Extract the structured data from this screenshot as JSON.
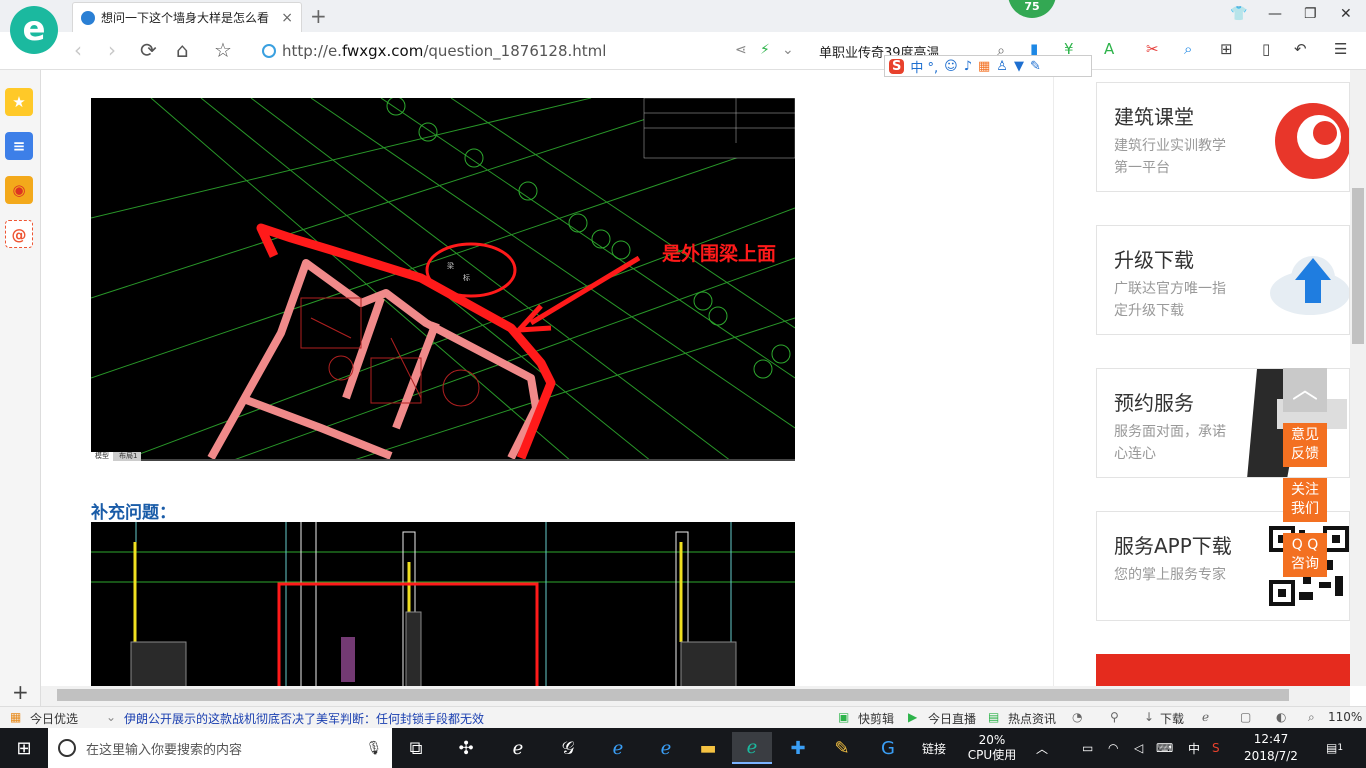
{
  "browser": {
    "logo_letter": "e",
    "tab_title": "想问一下这个墙身大样是怎么看",
    "tab_close": "×",
    "new_tab": "+",
    "badge": "75",
    "url_prefix": "http://e.",
    "url_domain": "fwxgx.com",
    "url_path": "/question_1876128.html",
    "search_text": "单职业传奇39度高温",
    "ime_logo": "S",
    "ime_mode": "中 °,"
  },
  "nav": {
    "back": "‹",
    "forward": "›",
    "reload": "⟳",
    "home": "⌂",
    "star": "☆"
  },
  "page": {
    "cad_annotation": "是外围梁上面",
    "cad_labels": [
      "模型",
      "布局1"
    ],
    "supplement_label": "补充问题："
  },
  "sidebar_cards": [
    {
      "title": "建筑课堂",
      "desc": "建筑行业实训教学第一平台"
    },
    {
      "title": "升级下载",
      "desc": "广联达官方唯一指定升级下载"
    },
    {
      "title": "预约服务",
      "desc": "服务面对面，承诺心连心"
    },
    {
      "title": "服务APP下载",
      "desc": "您的掌上服务专家"
    }
  ],
  "float_buttons": [
    "意见\n反馈",
    "关注\n我们",
    "Q Q\n咨询"
  ],
  "float_top_icon": "︿",
  "statusbar": {
    "today_picks": "今日优选",
    "news": "伊朗公开展示的这款战机彻底否决了美军判断：任何封锁手段都无效",
    "clip": "快剪辑",
    "live": "今日直播",
    "hot": "热点资讯",
    "download": "下载",
    "zoom": "110%"
  },
  "taskbar": {
    "search_placeholder": "在这里输入你要搜索的内容",
    "links_label": "链接",
    "cpu_percent": "20%",
    "cpu_label": "CPU使用",
    "ime": "中",
    "time": "12:47",
    "date": "2018/7/2",
    "notif_count": "1"
  },
  "colors": {
    "accent_green": "#1bb99f",
    "orange": "#f37021",
    "title_blue": "#1a5ca8",
    "cad_red": "#ff1a1a"
  }
}
